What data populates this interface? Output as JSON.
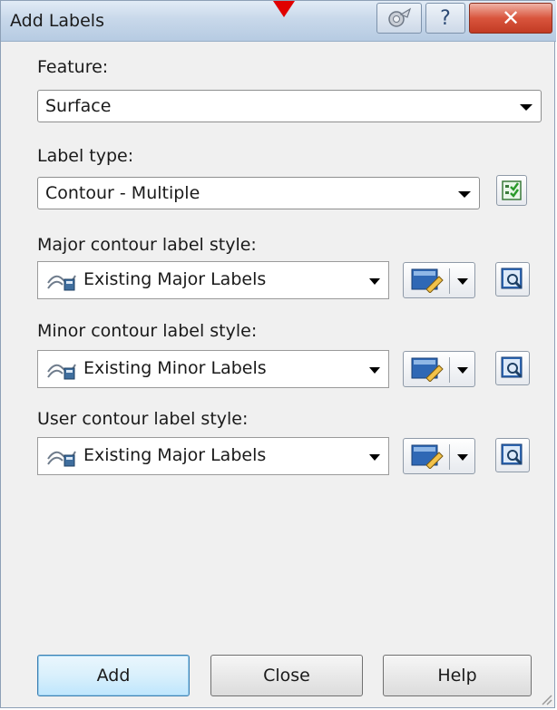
{
  "window": {
    "title": "Add Labels"
  },
  "title_buttons": {
    "pin_icon": "pin-icon",
    "help_glyph": "?",
    "close_glyph": "✕"
  },
  "feature": {
    "label": "Feature:",
    "value": "Surface"
  },
  "label_type": {
    "label": "Label type:",
    "value": "Contour - Multiple"
  },
  "major": {
    "label": "Major contour label style:",
    "value": "Existing Major Labels"
  },
  "minor": {
    "label": "Minor contour label style:",
    "value": "Existing Minor Labels"
  },
  "user": {
    "label": "User contour label style:",
    "value": "Existing Major Labels"
  },
  "buttons": {
    "add": "Add",
    "close": "Close",
    "help": "Help"
  },
  "colors": {
    "title_bar": "#c8d8ea",
    "close_button": "#d9553d",
    "default_button": "#d9f0fc",
    "marker": "#e00000"
  }
}
